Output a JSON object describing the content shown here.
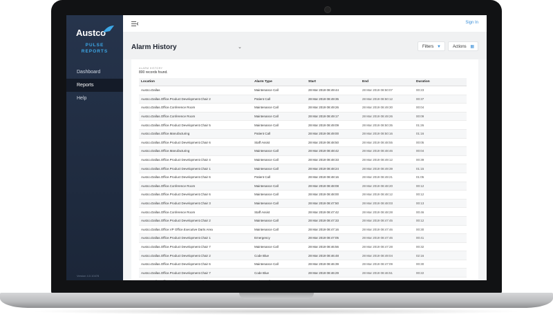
{
  "sidebar": {
    "logo": "Austco",
    "subtitle_line1": "PULSE",
    "subtitle_line2": "REPORTS",
    "items": [
      {
        "label": "Dashboard"
      },
      {
        "label": "Reports"
      },
      {
        "label": "Help"
      }
    ],
    "version": "Version 4.0.10478"
  },
  "topbar": {
    "signin_label": "Sign In"
  },
  "header": {
    "title": "Alarm History",
    "filters_label": "Filters",
    "actions_label": "Actions"
  },
  "report": {
    "section_label": "ALARM HISTORY",
    "count_text": "800 records found.",
    "columns": [
      "Location",
      "Alarm Type",
      "Start",
      "End",
      "Duration"
    ],
    "rows": [
      [
        "Austco.Dallas",
        "Maintenance Call",
        "28 Mar 2019 08:49:44",
        "28 Mar 2019 08:50:07",
        "00:23"
      ],
      [
        "Austco.Dallas.Office.Product Development.Chair 2",
        "Patient Call",
        "28 Mar 2019 08:49:35",
        "28 Mar 2019 08:50:12",
        "00:37"
      ],
      [
        "Austco.Dallas.Office.Conference Room",
        "Maintenance Call",
        "28 Mar 2019 08:49:26",
        "28 Mar 2019 08:49:30",
        "00:04"
      ],
      [
        "Austco.Dallas.Office.Conference Room",
        "Maintenance Call",
        "28 Mar 2019 08:49:17",
        "28 Mar 2019 08:49:26",
        "00:09"
      ],
      [
        "Austco.Dallas.Office.Product Development.Chair 5",
        "Maintenance Call",
        "28 Mar 2019 08:49:09",
        "28 Mar 2019 08:50:35",
        "01:26"
      ],
      [
        "Austco.Dallas.Office.Manufacturing",
        "Patient Call",
        "28 Mar 2019 08:49:00",
        "28 Mar 2019 08:50:16",
        "01:16"
      ],
      [
        "Austco.Dallas.Office.Product Development.Chair 6",
        "Staff Assist",
        "28 Mar 2019 08:48:50",
        "28 Mar 2019 08:48:55",
        "00:05"
      ],
      [
        "Austco.Dallas.Office.Manufacturing",
        "Maintenance Call",
        "28 Mar 2019 08:48:42",
        "28 Mar 2019 08:48:46",
        "00:04"
      ],
      [
        "Austco.Dallas.Office.Product Development.Chair 4",
        "Maintenance Call",
        "28 Mar 2019 08:48:33",
        "28 Mar 2019 08:49:12",
        "00:39"
      ],
      [
        "Austco.Dallas.Office.Product Development.Chair 1",
        "Maintenance Call",
        "28 Mar 2019 08:48:24",
        "28 Mar 2019 08:49:39",
        "01:15"
      ],
      [
        "Austco.Dallas.Office.Product Development.Chair 6",
        "Patient Call",
        "28 Mar 2019 08:48:16",
        "28 Mar 2019 08:49:21",
        "01:05"
      ],
      [
        "Austco.Dallas.Office.Conference Room",
        "Maintenance Call",
        "28 Mar 2019 08:48:08",
        "28 Mar 2019 08:48:20",
        "00:12"
      ],
      [
        "Austco.Dallas.Office.Product Development.Chair 6",
        "Maintenance Call",
        "28 Mar 2019 08:48:00",
        "28 Mar 2019 08:48:12",
        "00:12"
      ],
      [
        "Austco.Dallas.Office.Product Development.Chair 3",
        "Maintenance Call",
        "28 Mar 2019 08:47:50",
        "28 Mar 2019 08:48:03",
        "00:13"
      ],
      [
        "Austco.Dallas.Office.Conference Room",
        "Staff Assist",
        "28 Mar 2019 08:47:42",
        "28 Mar 2019 08:48:28",
        "00:46"
      ],
      [
        "Austco.Dallas.Office.Product Development.Chair 2",
        "Maintenance Call",
        "28 Mar 2019 08:47:33",
        "28 Mar 2019 08:47:45",
        "00:12"
      ],
      [
        "Austco.Dallas.Office.VP Office.Executive Darts Area",
        "Maintenance Call",
        "28 Mar 2019 08:47:16",
        "28 Mar 2019 08:47:46",
        "00:30"
      ],
      [
        "Austco.Dallas.Office.Product Development.Chair 1",
        "Emergency",
        "28 Mar 2019 08:47:05",
        "28 Mar 2019 08:47:46",
        "00:41"
      ],
      [
        "Austco.Dallas.Office.Product Development.Chair 7",
        "Maintenance Call",
        "28 Mar 2019 08:46:56",
        "28 Mar 2019 08:47:28",
        "00:32"
      ],
      [
        "Austco.Dallas.Office.Product Development.Chair 2",
        "Code Blue",
        "28 Mar 2019 08:46:48",
        "28 Mar 2019 08:49:04",
        "02:16"
      ],
      [
        "Austco.Dallas.Office.Product Development.Chair 6",
        "Maintenance Call",
        "28 Mar 2019 08:46:39",
        "28 Mar 2019 08:47:09",
        "00:30"
      ],
      [
        "Austco.Dallas.Office.Product Development.Chair 7",
        "Code Blue",
        "28 Mar 2019 08:46:29",
        "28 Mar 2019 08:46:51",
        "00:22"
      ],
      [
        "Austco.Dallas.Office.Product Development.Chair 6",
        "Patient Call",
        "28 Mar 2019 08:46:21",
        "28 Mar 2019 08:46:33",
        "00:12"
      ],
      [
        "Austco.Dallas.Office.Product Development.Chair 3",
        "Maintenance Call",
        "28 Mar 2019 08:46:12",
        "28 Mar 2019 08:48:36",
        "02:24"
      ]
    ]
  }
}
